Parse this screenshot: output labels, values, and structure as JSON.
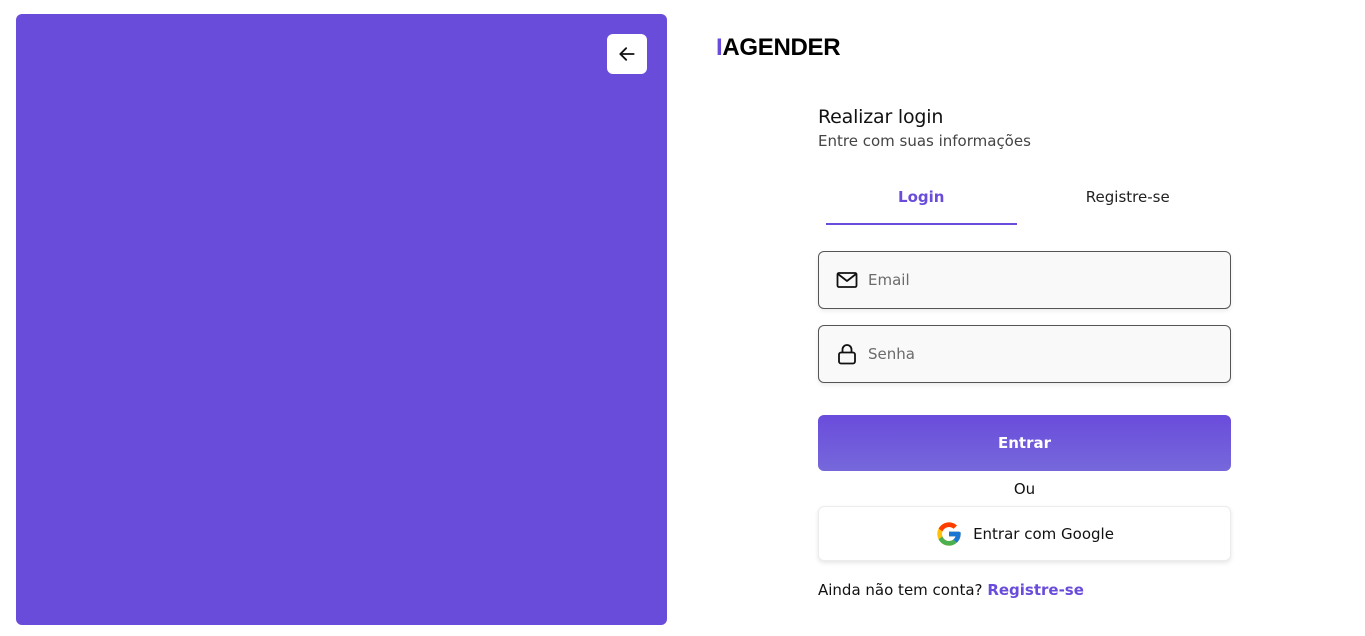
{
  "logo": {
    "accent_letter": "I",
    "rest": "AGENDER"
  },
  "back_button": {
    "icon": "arrow-left-icon"
  },
  "form": {
    "title": "Realizar login",
    "subtitle": "Entre com suas informações",
    "tabs": [
      {
        "label": "Login",
        "active": true
      },
      {
        "label": "Registre-se",
        "active": false
      }
    ],
    "email": {
      "placeholder": "Email",
      "value": "",
      "icon": "mail-icon"
    },
    "password": {
      "placeholder": "Senha",
      "value": "",
      "icon": "lock-icon"
    },
    "submit_label": "Entrar",
    "divider_label": "Ou",
    "google_label": "Entrar com Google",
    "footer": {
      "question": "Ainda não tem conta?",
      "link": "Registre-se"
    }
  },
  "colors": {
    "accent": "#6a4cdb",
    "hero_background": "#6a4cdb"
  }
}
